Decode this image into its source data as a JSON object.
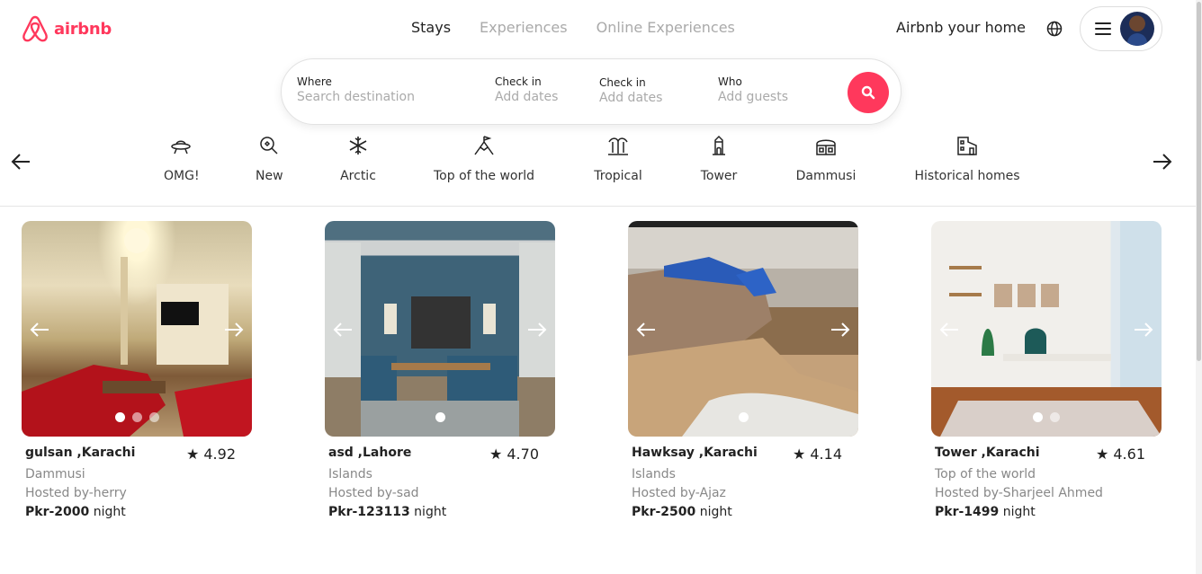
{
  "brand": {
    "name": "airbnb",
    "color": "#ff385c"
  },
  "nav": {
    "stays": "Stays",
    "experiences": "Experiences",
    "online": "Online Experiences"
  },
  "header": {
    "host_link": "Airbnb your home",
    "globe_icon": "globe-icon",
    "menu_icon": "hamburger-icon"
  },
  "search": {
    "where_label": "Where",
    "where_placeholder": "Search destination",
    "checkin_label": "Check in",
    "checkin_placeholder": "Add dates",
    "checkout_label": "Check in",
    "checkout_placeholder": "Add dates",
    "who_label": "Who",
    "who_placeholder": "Add guests",
    "button_icon": "search-icon"
  },
  "categories": [
    {
      "label": "OMG!",
      "icon": "ufo-icon"
    },
    {
      "label": "New",
      "icon": "new-sparkle-icon"
    },
    {
      "label": "Arctic",
      "icon": "snowflake-icon"
    },
    {
      "label": "Top of the world",
      "icon": "mountain-flag-icon"
    },
    {
      "label": "Tropical",
      "icon": "palm-tree-icon"
    },
    {
      "label": "Tower",
      "icon": "tower-icon"
    },
    {
      "label": "Dammusi",
      "icon": "dome-house-icon"
    },
    {
      "label": "Historical homes",
      "icon": "historical-home-icon"
    }
  ],
  "listings": [
    {
      "title": "gulsan ,Karachi",
      "rating": "★ 4.92",
      "category": "Dammusi",
      "host": "Hosted by-herry",
      "price": "Pkr-2000",
      "unit": " night"
    },
    {
      "title": "asd ,Lahore",
      "rating": "★ 4.70",
      "category": "Islands",
      "host": "Hosted by-sad",
      "price": "Pkr-123113",
      "unit": " night"
    },
    {
      "title": "Hawksay ,Karachi",
      "rating": "★ 4.14",
      "category": "Islands",
      "host": "Hosted by-Ajaz",
      "price": "Pkr-2500",
      "unit": " night"
    },
    {
      "title": "Tower ,Karachi",
      "rating": "★ 4.61",
      "category": "Top of the world",
      "host": "Hosted by-Sharjeel Ahmed",
      "price": "Pkr-1499",
      "unit": " night"
    }
  ]
}
